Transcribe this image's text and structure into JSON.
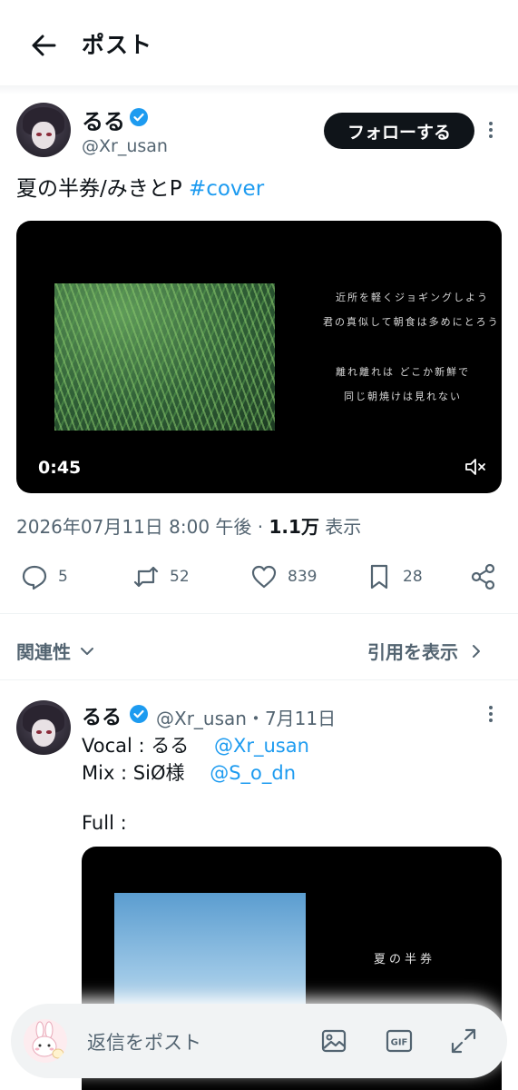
{
  "header": {
    "title": "ポスト",
    "back_icon": "arrow-left-icon"
  },
  "post": {
    "author_name": "るる",
    "author_handle": "@Xr_usan",
    "follow_label": "フォローする",
    "text": "夏の半券/みきとP ",
    "hashtag": "#cover",
    "video": {
      "duration": "0:45",
      "lyrics": [
        "近所を軽くジョギングしよう",
        "君の真似して朝食は多めにとろう",
        "離れ離れは どこか新鮮で",
        "同じ朝焼けは見れない"
      ]
    },
    "meta": {
      "datetime": "2026年07月11日 8:00 午後",
      "separator": " · ",
      "views": "1.1万",
      "views_label": " 表示"
    },
    "actions": {
      "replies": "5",
      "reposts": "52",
      "likes": "839",
      "bookmarks": "28"
    }
  },
  "sort": {
    "label": "関連性",
    "quotes_label": "引用を表示"
  },
  "reply": {
    "author_name": "るる",
    "author_handle": "@Xr_usan",
    "date": "・7月11日",
    "line1_prefix": "Vocal : るる　 ",
    "line1_mention": "@Xr_usan",
    "line2_prefix": "Mix : SiØ様　 ",
    "line2_mention": "@S_o_dn",
    "line3": "Full :",
    "video_title": "夏の半券"
  },
  "composer": {
    "placeholder": "返信をポスト"
  },
  "colors": {
    "accent": "#1d9bf0",
    "text": "#0f1419",
    "secondary": "#536471"
  }
}
